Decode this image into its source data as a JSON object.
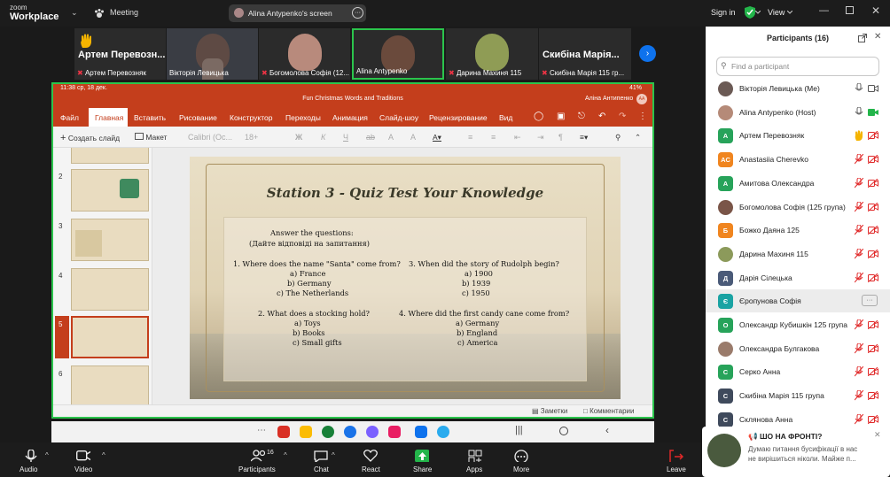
{
  "topbar": {
    "logo_line1": "zoom",
    "logo_line2": "Workplace",
    "meeting_label": "Meeting",
    "share_title": "Alina Antypenko's screen",
    "sign_in": "Sign in",
    "view": "View"
  },
  "tiles": [
    {
      "big": "Артем Перевозн...",
      "name": "Артем Перевозняк",
      "muted": true
    },
    {
      "big": "",
      "name": "Вікторія Левицька",
      "muted": false
    },
    {
      "big": "",
      "name": "Богомолова Софія (12...",
      "muted": true
    },
    {
      "big": "",
      "name": "Alina Antypenko",
      "muted": false
    },
    {
      "big": "",
      "name": "Дарина Махиня 115",
      "muted": true
    },
    {
      "big": "Скибіна Марія...",
      "name": "Скибіна Марія 115 гр...",
      "muted": true
    }
  ],
  "panel": {
    "title": "Participants (16)",
    "find_placeholder": "Find a participant",
    "participants": [
      {
        "name": "Вікторія Левицька (Me)",
        "initials": "",
        "color": "#6b5a55",
        "photo": true
      },
      {
        "name": "Alina Antypenko (Host)",
        "initials": "",
        "color": "#b58a78",
        "photo": true
      },
      {
        "name": "Артем Перевозняк",
        "initials": "А",
        "color": "#27a35a",
        "photo": false
      },
      {
        "name": "Anastasiia Cherevko",
        "initials": "AC",
        "color": "#f0851f",
        "photo": false
      },
      {
        "name": "Амитова Олександра",
        "initials": "А",
        "color": "#27a35a",
        "photo": false
      },
      {
        "name": "Богомолова Софія (125 група)",
        "initials": "",
        "color": "#7a5548",
        "photo": true
      },
      {
        "name": "Божко Даяна 125",
        "initials": "Б",
        "color": "#f0851f",
        "photo": false
      },
      {
        "name": "Дарина Махиня 115",
        "initials": "",
        "color": "#8c9a5b",
        "photo": true
      },
      {
        "name": "Дарія Сілецька",
        "initials": "Д",
        "color": "#4a5a78",
        "photo": false
      },
      {
        "name": "Єропунова Софія",
        "initials": "Є",
        "color": "#1aa3a3",
        "photo": false
      },
      {
        "name": "Олександр Кубишкін 125 група",
        "initials": "О",
        "color": "#27a35a",
        "photo": false
      },
      {
        "name": "Олександра Булгакова",
        "initials": "",
        "color": "#9a7b6b",
        "photo": true
      },
      {
        "name": "Серко Анна",
        "initials": "С",
        "color": "#27a35a",
        "photo": false
      },
      {
        "name": "Скибіна Марія 115 група",
        "initials": "С",
        "color": "#3f4a5c",
        "photo": false
      },
      {
        "name": "Склянова Анна",
        "initials": "С",
        "color": "#3f4a5c",
        "photo": false
      }
    ]
  },
  "ppt": {
    "status_left": "11:38  ср, 18 дек.",
    "status_right": "41%",
    "doc_title": "Fun Christmas Words and Traditions",
    "user": "Аліна Антипенко",
    "user_initials": "АА",
    "menu": [
      "Файл",
      "Главная",
      "Вставить",
      "Рисование",
      "Конструктор",
      "Переходы",
      "Анимация",
      "Слайд-шоу",
      "Рецензирование",
      "Вид"
    ],
    "ribbon": {
      "new_slide": "Создать слайд",
      "layout": "Макет",
      "font": "Calibri (Ос...",
      "size": "18+"
    },
    "slide_numbers": [
      "2",
      "3",
      "4",
      "5",
      "6"
    ],
    "notes": "Заметки",
    "comments": "Комментарии"
  },
  "slide": {
    "title": "Station 3 - Quiz Test Your Knowledge",
    "intro1": "Answer the questions:",
    "intro2": "(Дайте відповіді на запитання)",
    "q1": "1. Where does the name \"Santa\" come from?",
    "q1a": [
      "a)  France",
      "b) Germany",
      "c) The Netherlands"
    ],
    "q2": "2. What does a stocking hold?",
    "q2a": [
      "a)  Toys",
      "b) Books",
      "c) Small gifts"
    ],
    "q3": "3. When did the story of Rudolph begin?",
    "q3a": [
      "a)  1900",
      "b) 1939",
      "c) 1950"
    ],
    "q4": "4. Where did the first candy cane come from?",
    "q4a": [
      "a)  Germany",
      "b) England",
      "c) America"
    ]
  },
  "zoombar": {
    "audio": "Audio",
    "video": "Video",
    "participants": "Participants",
    "participants_count": "16",
    "chat": "Chat",
    "react": "React",
    "share": "Share",
    "apps": "Apps",
    "more": "More",
    "leave": "Leave"
  },
  "notification": {
    "title": "ШО НА ФРОНТІ?",
    "line1": "Думаю питання бусифікації в нас",
    "line2": "не вирішиться ніколи. Майже п..."
  }
}
